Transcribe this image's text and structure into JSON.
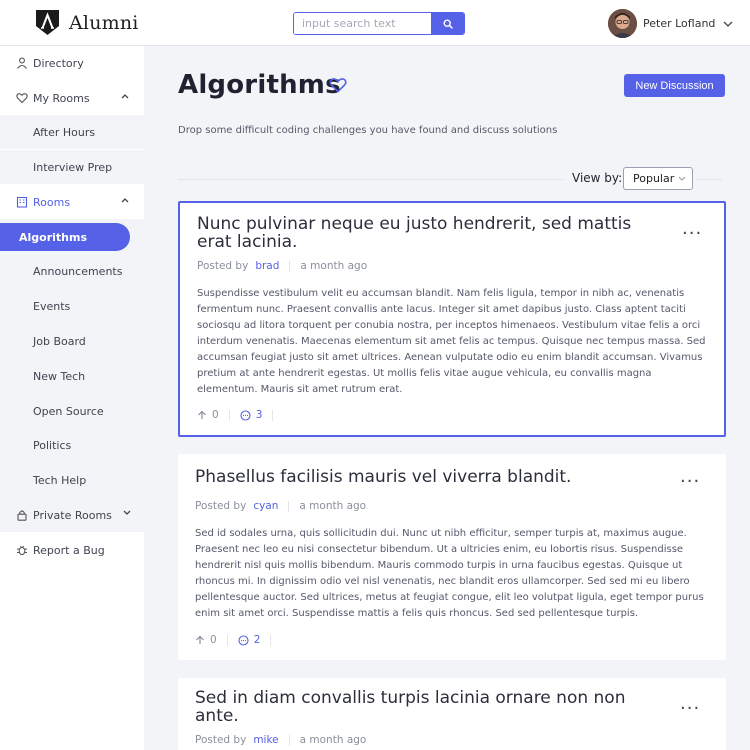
{
  "app": {
    "name": "Alumni",
    "search_placeholder": "input search text",
    "user_name": "Peter Lofland"
  },
  "colors": {
    "accent": "#5561e6",
    "background": "#f3f4f7",
    "text": "#1f2230"
  },
  "sidebar": {
    "directory": "Directory",
    "my_rooms": "My Rooms",
    "my_rooms_items": [
      "After Hours",
      "Interview Prep"
    ],
    "rooms": "Rooms",
    "rooms_items": [
      "Algorithms",
      "Announcements",
      "Events",
      "Job Board",
      "New Tech",
      "Open Source",
      "Politics",
      "Tech Help"
    ],
    "private_rooms": "Private Rooms",
    "report_bug": "Report a Bug"
  },
  "page": {
    "title": "Algorithms",
    "description": "Drop some difficult coding challenges you have found and discuss solutions",
    "new_button": "New Discussion",
    "view_by_label": "View by:",
    "view_by_value": "Popular"
  },
  "posts": [
    {
      "title": "Nunc pulvinar neque eu justo hendrerit, sed mattis erat lacinia.",
      "posted_by_label": "Posted by",
      "author": "brad",
      "time": "a month ago",
      "body": "Suspendisse vestibulum velit eu accumsan blandit. Nam felis ligula, tempor in nibh ac, venenatis fermentum nunc. Praesent convallis ante lacus. Integer sit amet dapibus justo. Class aptent taciti sociosqu ad litora torquent per conubia nostra, per inceptos himenaeos. Vestibulum vitae felis a orci interdum venenatis. Maecenas elementum sit amet felis ac tempus. Quisque nec tempus massa. Sed accumsan feugiat justo sit amet ultrices. Aenean vulputate odio eu enim blandit accumsan. Vivamus pretium at ante hendrerit egestas. Ut mollis felis vitae augue vehicula, eu convallis magna elementum. Mauris sit amet rutrum erat.",
      "upvotes": "0",
      "comments": "3",
      "more": "..."
    },
    {
      "title": "Phasellus facilisis mauris vel viverra blandit.",
      "posted_by_label": "Posted by",
      "author": "cyan",
      "time": "a month ago",
      "body": "Sed id sodales urna, quis sollicitudin dui. Nunc ut nibh efficitur, semper turpis at, maximus augue. Praesent nec leo eu nisi consectetur bibendum. Ut a ultricies enim, eu lobortis risus. Suspendisse hendrerit nisl quis mollis bibendum. Mauris commodo turpis in urna faucibus egestas. Quisque ut rhoncus mi. In dignissim odio vel nisl venenatis, nec blandit eros ullamcorper. Sed sed mi eu libero pellentesque auctor. Sed ultrices, metus at feugiat congue, elit leo volutpat ligula, eget tempor purus enim sit amet orci. Suspendisse mattis a felis quis rhoncus. Sed sed pellentesque turpis.",
      "upvotes": "0",
      "comments": "2",
      "more": "..."
    },
    {
      "title": "Sed in diam convallis turpis lacinia ornare non non ante.",
      "posted_by_label": "Posted by",
      "author": "mike",
      "time": "a month ago",
      "more": "..."
    }
  ]
}
